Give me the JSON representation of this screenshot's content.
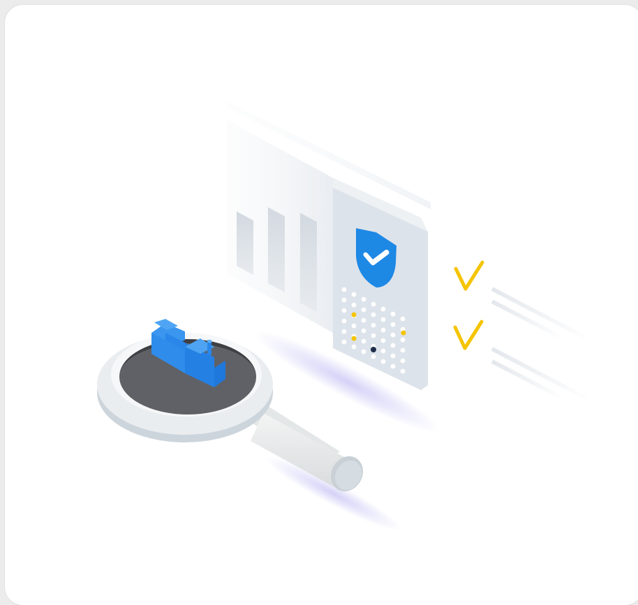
{
  "illustration": {
    "subject": "security-scan",
    "icons": [
      "shield-check-icon",
      "checkmark-icon",
      "magnifying-glass-icon",
      "factory-icon",
      "bar-chart-icon"
    ],
    "colors": {
      "shield_blue": "#1e88e5",
      "factory_blue": "#2a86e8",
      "checkmark_yellow": "#f5c400",
      "panel_gray": "#dde3ea",
      "lens_dark": "#5f6166",
      "indicator_navy": "#1f2d4a"
    },
    "checkmark_count": 2
  }
}
